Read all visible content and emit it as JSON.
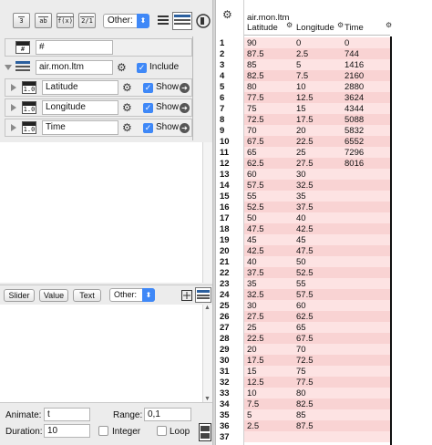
{
  "toolbar": {
    "buttons": [
      "3",
      "ab",
      "f(x)",
      "2/1"
    ],
    "other_label": "Other:",
    "other_arrow": "⬍"
  },
  "filter": {
    "hash_badge": "#",
    "value": "#"
  },
  "dataset": {
    "name": "air.mon.ltm",
    "include_label": "Include",
    "include_checked": true
  },
  "variables": [
    {
      "badge": "1.0",
      "name": "Latitude",
      "show_label": "Show"
    },
    {
      "badge": "1.0",
      "name": "Longitude",
      "show_label": "Show"
    },
    {
      "badge": "1.0",
      "name": "Time",
      "show_label": "Show"
    }
  ],
  "bottom_toolbar": {
    "slider": "Slider",
    "value": "Value",
    "text": "Text",
    "other": "Other:"
  },
  "animate": {
    "animate_label": "Animate:",
    "animate_value": "t",
    "range_label": "Range:",
    "range_value": "0,1",
    "duration_label": "Duration:",
    "duration_value": "10",
    "integer_label": "Integer",
    "loop_label": "Loop"
  },
  "table": {
    "dataset_title": "air.mon.ltm",
    "columns": [
      "Latitude",
      "Longitude",
      "Time"
    ],
    "rows": [
      [
        "1",
        "90",
        "0",
        "0"
      ],
      [
        "2",
        "87.5",
        "2.5",
        "744"
      ],
      [
        "3",
        "85",
        "5",
        "1416"
      ],
      [
        "4",
        "82.5",
        "7.5",
        "2160"
      ],
      [
        "5",
        "80",
        "10",
        "2880"
      ],
      [
        "6",
        "77.5",
        "12.5",
        "3624"
      ],
      [
        "7",
        "75",
        "15",
        "4344"
      ],
      [
        "8",
        "72.5",
        "17.5",
        "5088"
      ],
      [
        "9",
        "70",
        "20",
        "5832"
      ],
      [
        "10",
        "67.5",
        "22.5",
        "6552"
      ],
      [
        "11",
        "65",
        "25",
        "7296"
      ],
      [
        "12",
        "62.5",
        "27.5",
        "8016"
      ],
      [
        "13",
        "60",
        "30",
        ""
      ],
      [
        "14",
        "57.5",
        "32.5",
        ""
      ],
      [
        "15",
        "55",
        "35",
        ""
      ],
      [
        "16",
        "52.5",
        "37.5",
        ""
      ],
      [
        "17",
        "50",
        "40",
        ""
      ],
      [
        "18",
        "47.5",
        "42.5",
        ""
      ],
      [
        "19",
        "45",
        "45",
        ""
      ],
      [
        "20",
        "42.5",
        "47.5",
        ""
      ],
      [
        "21",
        "40",
        "50",
        ""
      ],
      [
        "22",
        "37.5",
        "52.5",
        ""
      ],
      [
        "23",
        "35",
        "55",
        ""
      ],
      [
        "24",
        "32.5",
        "57.5",
        ""
      ],
      [
        "25",
        "30",
        "60",
        ""
      ],
      [
        "26",
        "27.5",
        "62.5",
        ""
      ],
      [
        "27",
        "25",
        "65",
        ""
      ],
      [
        "28",
        "22.5",
        "67.5",
        ""
      ],
      [
        "29",
        "20",
        "70",
        ""
      ],
      [
        "30",
        "17.5",
        "72.5",
        ""
      ],
      [
        "31",
        "15",
        "75",
        ""
      ],
      [
        "32",
        "12.5",
        "77.5",
        ""
      ],
      [
        "33",
        "10",
        "80",
        ""
      ],
      [
        "34",
        "7.5",
        "82.5",
        ""
      ],
      [
        "35",
        "5",
        "85",
        ""
      ],
      [
        "36",
        "2.5",
        "87.5",
        ""
      ],
      [
        "37",
        "",
        "",
        ""
      ]
    ]
  },
  "colors": {
    "accent": "#3f88f7",
    "cell_fill": "#fde3e3",
    "cell_fill_alt": "#f9d3d3"
  }
}
